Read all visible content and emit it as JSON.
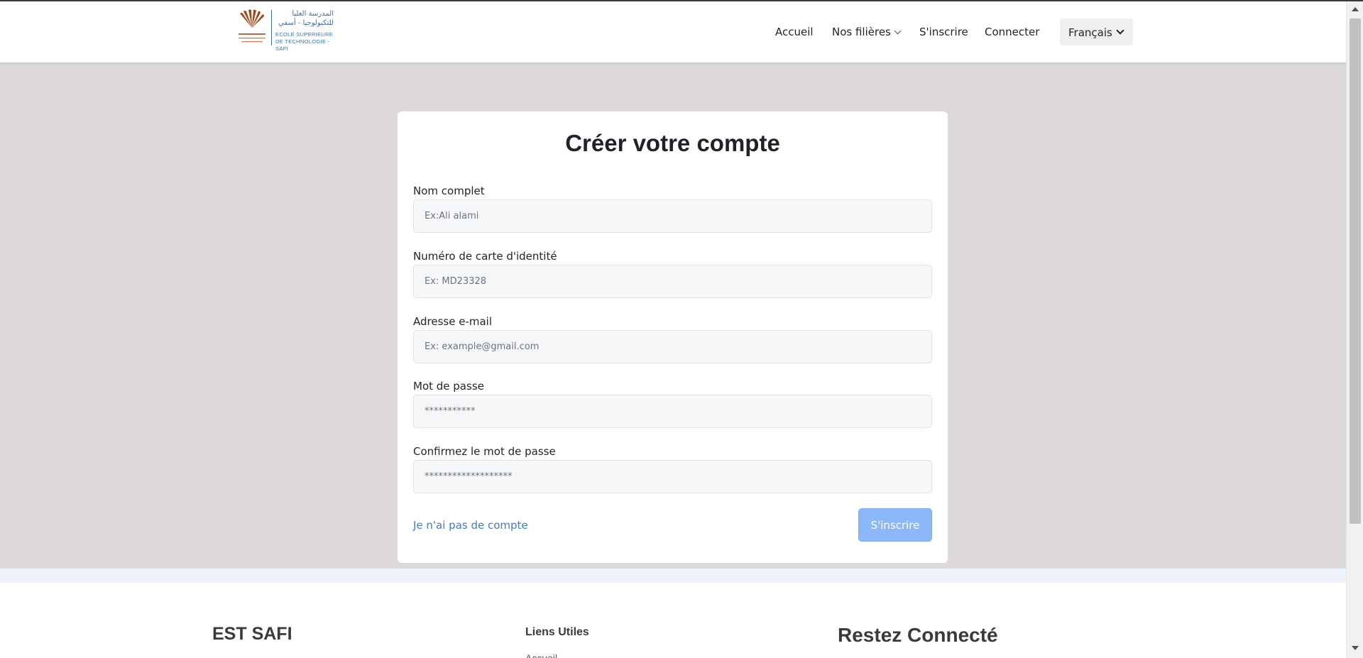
{
  "header": {
    "logo": {
      "arabic_line1": "المدرسة العليا",
      "arabic_line2": "للتكنولوجيا - أسفي",
      "french_line1": "ECOLE  SUPERIEURE",
      "french_line2": "DE TECHNOLOGIE -SAFI",
      "brand_color": "#3b6fa8"
    },
    "nav": {
      "accueil": "Accueil",
      "filieres": "Nos filières",
      "inscrire": "S'inscrire",
      "connecter": "Connecter"
    },
    "language": "Français"
  },
  "form": {
    "title": "Créer votre compte",
    "fields": [
      {
        "label": "Nom complet",
        "placeholder": "Ex:Ali alami",
        "value": ""
      },
      {
        "label": "Numéro de carte d'identité",
        "placeholder": "Ex: MD23328",
        "value": ""
      },
      {
        "label": "Adresse e-mail",
        "placeholder": "Ex: example@gmail.com",
        "value": ""
      },
      {
        "label": "Mot de passe",
        "placeholder": "***********",
        "value": ""
      },
      {
        "label": "Confirmez le mot de passe",
        "placeholder": "*******************",
        "value": ""
      }
    ],
    "no_account_link": "Je n'ai pas de compte",
    "submit_label": "S'inscrire",
    "submit_color": "#8bb8f8",
    "link_color": "#4a78b8"
  },
  "footer": {
    "brand": "EST SAFI",
    "links_title": "Liens Utiles",
    "links_first": "Accueil",
    "connected_title": "Restez Connecté"
  }
}
